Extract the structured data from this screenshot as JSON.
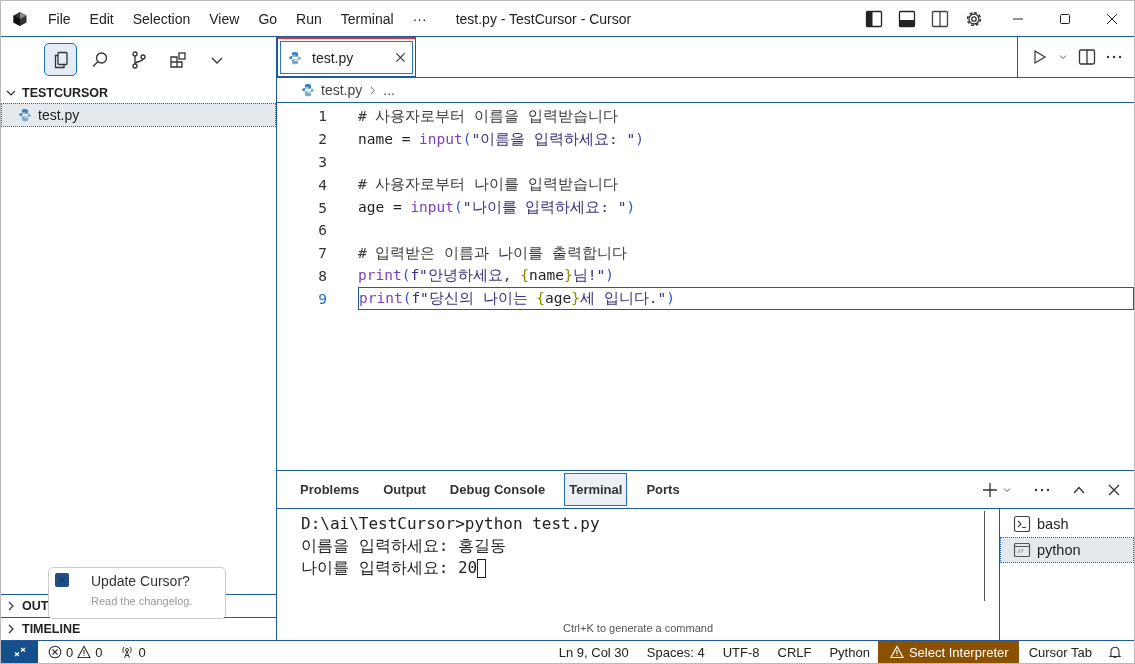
{
  "window": {
    "title": "test.py - TestCursor - Cursor"
  },
  "menu": [
    "File",
    "Edit",
    "Selection",
    "View",
    "Go",
    "Run",
    "Terminal",
    "···"
  ],
  "activity": [
    {
      "kind": "files",
      "selected": true
    },
    {
      "kind": "search",
      "selected": false
    },
    {
      "kind": "branch",
      "selected": false
    },
    {
      "kind": "extensions",
      "selected": false
    },
    {
      "kind": "chevron",
      "selected": false
    }
  ],
  "explorer": {
    "title": "TESTCURSOR",
    "expanded": true,
    "files": [
      {
        "name": "test.py",
        "selected": true
      }
    ],
    "sections": [
      {
        "title": "OUT",
        "expanded": false
      },
      {
        "title": "TIMELINE",
        "expanded": false
      }
    ]
  },
  "editor_tabs": [
    {
      "label": "test.py",
      "selected": true
    }
  ],
  "breadcrumb": {
    "file": "test.py",
    "rest": "..."
  },
  "code": [
    {
      "number": "1",
      "current": false,
      "tokens": [
        {
          "kind": "comment",
          "text": "# 사용자로부터 이름을 입력받습니다"
        }
      ]
    },
    {
      "number": "2",
      "current": false,
      "tokens": [
        {
          "kind": "plain",
          "text": "name = "
        },
        {
          "kind": "func",
          "text": "input"
        },
        {
          "kind": "paren",
          "text": "("
        },
        {
          "kind": "string",
          "text": "\"이름을 입력하세요: \""
        },
        {
          "kind": "paren",
          "text": ")"
        }
      ]
    },
    {
      "number": "3",
      "current": false
    },
    {
      "number": "4",
      "current": false,
      "tokens": [
        {
          "kind": "comment",
          "text": "# 사용자로부터 나이를 입력받습니다"
        }
      ]
    },
    {
      "number": "5",
      "current": false,
      "tokens": [
        {
          "kind": "plain",
          "text": "age = "
        },
        {
          "kind": "func",
          "text": "input"
        },
        {
          "kind": "paren",
          "text": "("
        },
        {
          "kind": "string",
          "text": "\"나이를 입력하세요: \""
        },
        {
          "kind": "paren",
          "text": ")"
        }
      ]
    },
    {
      "number": "6",
      "current": false
    },
    {
      "number": "7",
      "current": false,
      "tokens": [
        {
          "kind": "comment",
          "text": "# 입력받은 이름과 나이를 출력합니다"
        }
      ]
    },
    {
      "number": "8",
      "current": false,
      "tokens": [
        {
          "kind": "func",
          "text": "print"
        },
        {
          "kind": "paren",
          "text": "("
        },
        {
          "kind": "string",
          "text": "f\"안녕하세요, "
        },
        {
          "kind": "brace",
          "text": "{"
        },
        {
          "kind": "plain",
          "text": "name"
        },
        {
          "kind": "brace",
          "text": "}"
        },
        {
          "kind": "string",
          "text": "님!\""
        },
        {
          "kind": "paren",
          "text": ")"
        }
      ]
    },
    {
      "number": "9",
      "current": true,
      "tokens": [
        {
          "kind": "func",
          "text": "print"
        },
        {
          "kind": "paren",
          "text": "("
        },
        {
          "kind": "string",
          "text": "f\"당신의 나이는 "
        },
        {
          "kind": "brace",
          "text": "{"
        },
        {
          "kind": "plain",
          "text": "age"
        },
        {
          "kind": "brace",
          "text": "}"
        },
        {
          "kind": "string",
          "text": "세 입니다.\""
        },
        {
          "kind": "paren",
          "text": ")"
        }
      ]
    }
  ],
  "panel_tabs": [
    {
      "label": "Problems",
      "selected": false
    },
    {
      "label": "Output",
      "selected": false
    },
    {
      "label": "Debug Console",
      "selected": false
    },
    {
      "label": "Terminal",
      "selected": true
    },
    {
      "label": "Ports",
      "selected": false
    }
  ],
  "terminal": {
    "lines": [
      "D:\\ai\\TestCursor>python test.py",
      "이름을 입력하세요: 홍길동",
      "나이를 입력하세요: 20"
    ],
    "hint": "Ctrl+K to generate a command"
  },
  "terminals": [
    {
      "kind": "bash",
      "name": "bash",
      "selected": false
    },
    {
      "kind": "cmd",
      "name": "python",
      "selected": true
    }
  ],
  "notification": {
    "title": "Update Cursor?",
    "message": "Read the changelog."
  },
  "status_bar": {
    "errors": "0",
    "warnings": "0",
    "ports": "0",
    "items": [
      "Ln 9, Col 30",
      "Spaces: 4",
      "UTF-8",
      "CRLF",
      "Python"
    ],
    "warning": "Select Interpreter",
    "cursor_tab": "Cursor Tab"
  }
}
